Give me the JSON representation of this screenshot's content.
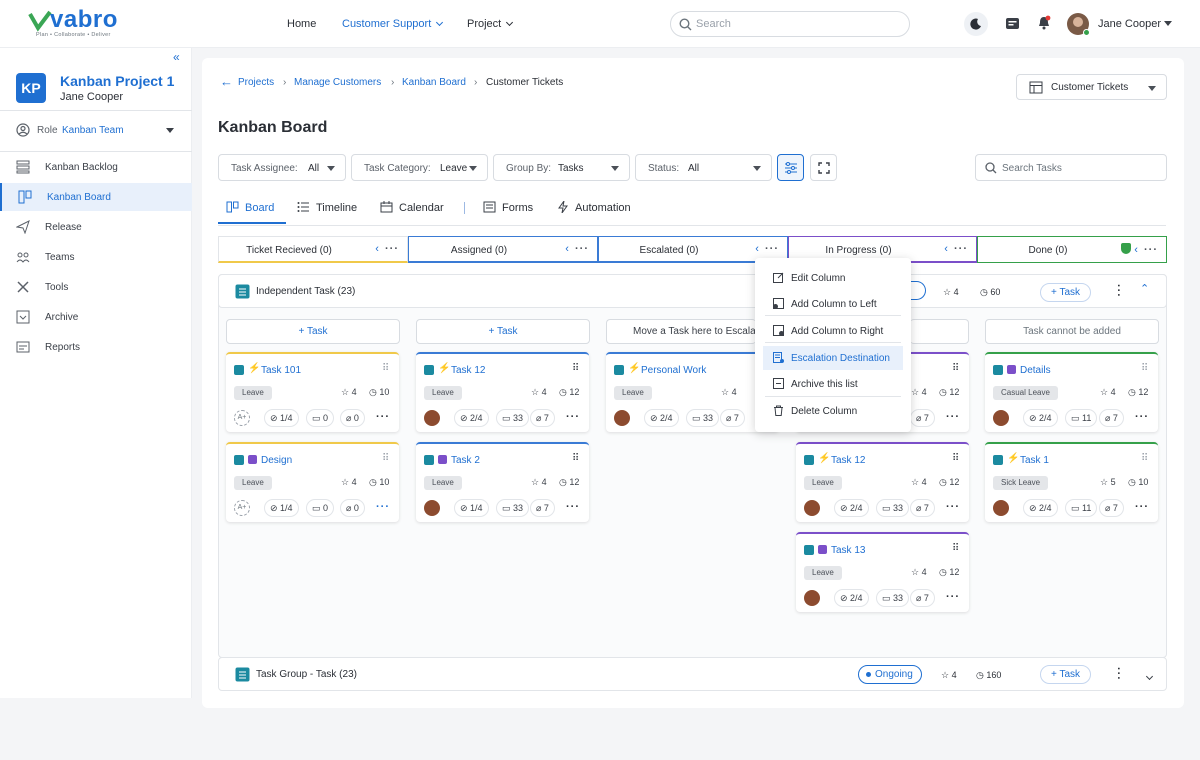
{
  "brand": {
    "name": "vabro",
    "tagline": "Plan • Collaborate • Deliver",
    "color": "#1f6fd1"
  },
  "topnav": {
    "items": [
      "Home",
      "Customer Support",
      "Project"
    ],
    "active": "Customer Support",
    "search_placeholder": "Search",
    "user": "Jane Cooper"
  },
  "sidebar": {
    "project_initials": "KP",
    "project_title": "Kanban Project 1",
    "project_owner": "Jane Cooper",
    "role_label": "Role",
    "role_value": "Kanban Team",
    "items": [
      "Kanban Backlog",
      "Kanban Board",
      "Release",
      "Teams",
      "Tools",
      "Archive",
      "Reports"
    ],
    "active": "Kanban Board"
  },
  "breadcrumb": [
    "Projects",
    "Manage Customers",
    "Kanban Board",
    "Customer Tickets"
  ],
  "view_select": "Customer Tickets",
  "page_title": "Kanban Board",
  "filters": [
    {
      "key": "Task Assignee:",
      "value": "All"
    },
    {
      "key": "Task Category:",
      "value": "Leave"
    },
    {
      "key": "Group By:",
      "value": "Tasks"
    },
    {
      "key": "Status:",
      "value": "All"
    }
  ],
  "search_tasks_placeholder": "Search Tasks",
  "tabs": [
    "Board",
    "Timeline",
    "Calendar",
    "Forms",
    "Automation"
  ],
  "active_tab": "Board",
  "columns": [
    {
      "title": "Ticket Recieved (0)",
      "color": "#f0c94a"
    },
    {
      "title": "Assigned (0)",
      "color": "#3a7bd5"
    },
    {
      "title": "Escalated (0)",
      "color": "#3a7bd5"
    },
    {
      "title": "In Progress (0)",
      "color": "#7b4fc9"
    },
    {
      "title": "Done (0)",
      "color": "#35a04a"
    }
  ],
  "group1": {
    "title": "Independent Task (23)",
    "status": "Ongoing",
    "stars": "4",
    "time": "60",
    "add": "+ Task"
  },
  "group2": {
    "title": "Task Group - Task (23)",
    "status": "Ongoing",
    "stars": "4",
    "time": "160",
    "add": "+ Task"
  },
  "add_row": [
    "+ Task",
    "+ Task",
    "Move a Task here to Escalate",
    "",
    "Task cannot be added"
  ],
  "cards": {
    "c1": {
      "title": "Task 101",
      "tag": "Leave",
      "stars": "4",
      "time": "10",
      "checks": "1/4",
      "comments": "0",
      "attach": "0"
    },
    "c2": {
      "title": "Design",
      "tag": "Leave",
      "stars": "4",
      "time": "10",
      "checks": "1/4",
      "comments": "0",
      "attach": "0"
    },
    "c3": {
      "title": "Task 12",
      "tag": "Leave",
      "stars": "4",
      "time": "12",
      "checks": "2/4",
      "comments": "33",
      "attach": "7"
    },
    "c4": {
      "title": "Task 2",
      "tag": "Leave",
      "stars": "4",
      "time": "12",
      "checks": "1/4",
      "comments": "33",
      "attach": "7"
    },
    "c5": {
      "title": "Personal Work",
      "tag": "Leave",
      "stars": "4",
      "time": "12",
      "checks": "2/4",
      "comments": "33",
      "attach": "7"
    },
    "c6": {
      "title": "",
      "tag": "",
      "stars": "4",
      "time": "12",
      "checks": "",
      "comments": "",
      "attach": "7"
    },
    "c7": {
      "title": "Task 12",
      "tag": "Leave",
      "stars": "4",
      "time": "12",
      "checks": "2/4",
      "comments": "33",
      "attach": "7"
    },
    "c8": {
      "title": "Task 13",
      "tag": "Leave",
      "stars": "4",
      "time": "12",
      "checks": "2/4",
      "comments": "33",
      "attach": "7"
    },
    "c9": {
      "title": "Details",
      "tag": "Casual Leave",
      "stars": "4",
      "time": "12",
      "checks": "2/4",
      "comments": "11",
      "attach": "7"
    },
    "c10": {
      "title": "Task 1",
      "tag": "Sick Leave",
      "stars": "5",
      "time": "10",
      "checks": "2/4",
      "comments": "11",
      "attach": "7"
    }
  },
  "context_menu": [
    "Edit Column",
    "Add Column to Left",
    "Add Column to Right",
    "Escalation Destination",
    "Archive this list",
    "Delete Column"
  ],
  "context_menu_highlight": "Escalation Destination"
}
